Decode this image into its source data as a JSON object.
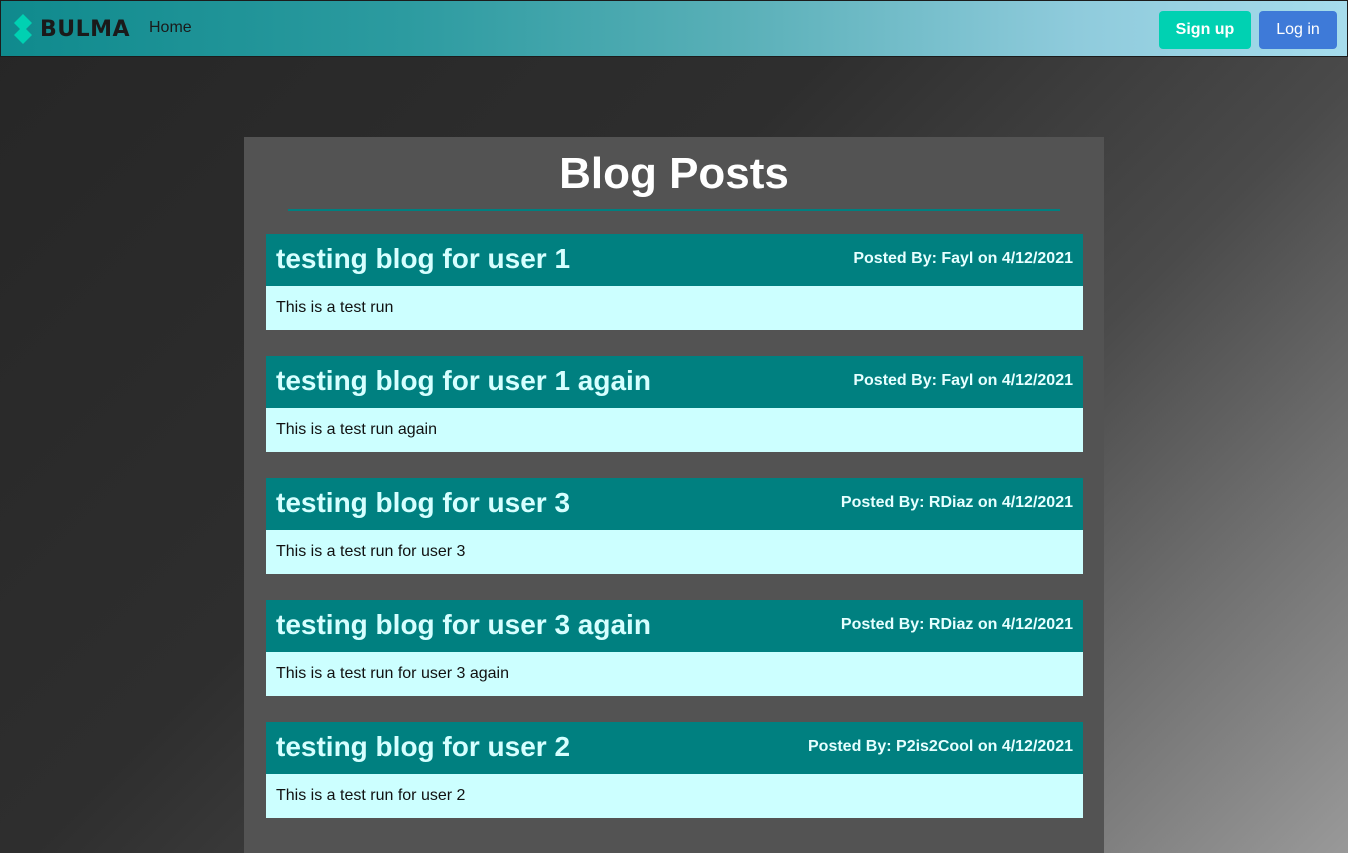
{
  "navbar": {
    "brand": "BULMA",
    "home": "Home",
    "signup": "Sign up",
    "login": "Log in"
  },
  "main": {
    "title": "Blog Posts",
    "posts": [
      {
        "title": "testing blog for user 1",
        "meta": "Posted By: Fayl on 4/12/2021",
        "body": "This is a test run"
      },
      {
        "title": "testing blog for user 1 again",
        "meta": "Posted By: Fayl on 4/12/2021",
        "body": "This is a test run again"
      },
      {
        "title": "testing blog for user 3",
        "meta": "Posted By: RDiaz on 4/12/2021",
        "body": "This is a test run for user 3"
      },
      {
        "title": "testing blog for user 3 again",
        "meta": "Posted By: RDiaz on 4/12/2021",
        "body": "This is a test run for user 3 again"
      },
      {
        "title": "testing blog for user 2",
        "meta": "Posted By: P2is2Cool on 4/12/2021",
        "body": "This is a test run for user 2"
      }
    ]
  },
  "colors": {
    "accent": "#008080",
    "post_body": "#ccffff",
    "signup": "#00d1b2",
    "login": "#3e7ad8"
  }
}
